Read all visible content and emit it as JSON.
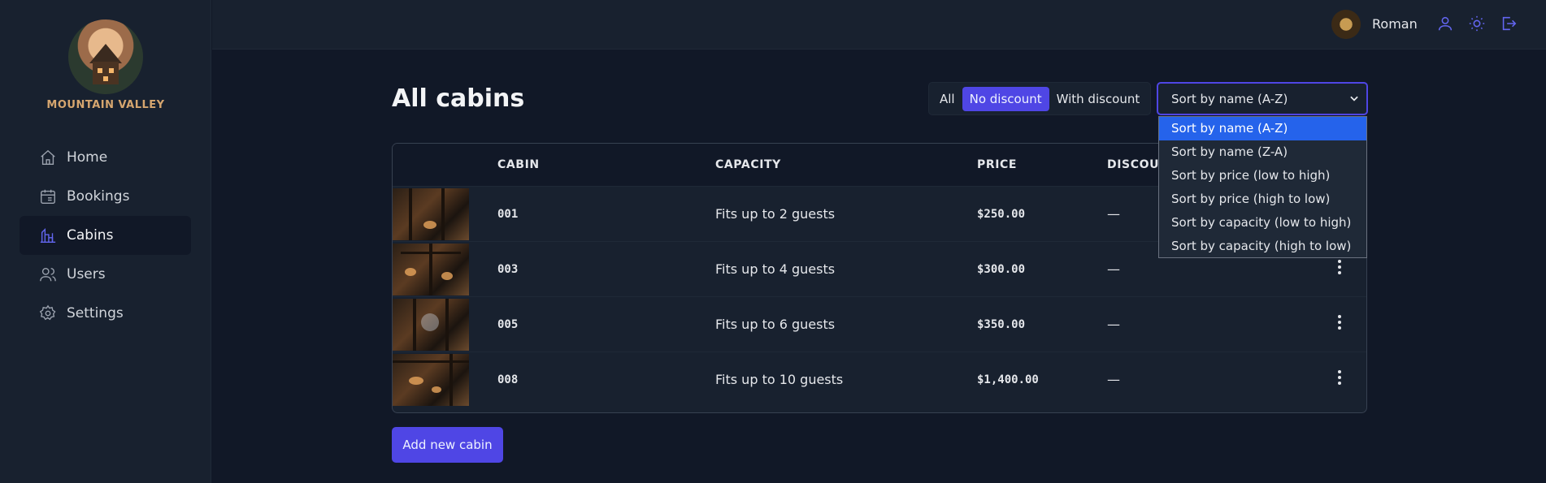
{
  "brand": {
    "name": "MOUNTAIN VALLEY"
  },
  "sidebar": {
    "items": [
      {
        "label": "Home",
        "icon": "home-icon"
      },
      {
        "label": "Bookings",
        "icon": "calendar-icon"
      },
      {
        "label": "Cabins",
        "icon": "cabins-icon",
        "active": true
      },
      {
        "label": "Users",
        "icon": "users-icon"
      },
      {
        "label": "Settings",
        "icon": "gear-icon"
      }
    ]
  },
  "header": {
    "user_name": "Roman",
    "icons": [
      "user-icon",
      "sun-icon",
      "logout-icon"
    ]
  },
  "main": {
    "title": "All cabins",
    "filter": {
      "options": [
        "All",
        "No discount",
        "With discount"
      ],
      "active": "No discount"
    },
    "sort": {
      "value": "Sort by name (A-Z)",
      "options": [
        "Sort by name (A-Z)",
        "Sort by name (Z-A)",
        "Sort by price (low to high)",
        "Sort by price (high to low)",
        "Sort by capacity (low to high)",
        "Sort by capacity (high to low)"
      ]
    },
    "table": {
      "headers": [
        "",
        "Cabin",
        "Capacity",
        "Price",
        "Discount"
      ],
      "rows": [
        {
          "cabin": "001",
          "capacity": "Fits up to 2 guests",
          "price": "$250.00",
          "discount": "—"
        },
        {
          "cabin": "003",
          "capacity": "Fits up to 4 guests",
          "price": "$300.00",
          "discount": "—"
        },
        {
          "cabin": "005",
          "capacity": "Fits up to 6 guests",
          "price": "$350.00",
          "discount": "—"
        },
        {
          "cabin": "008",
          "capacity": "Fits up to 10 guests",
          "price": "$1,400.00",
          "discount": "—"
        }
      ]
    },
    "add_button": "Add new cabin"
  },
  "colors": {
    "accent": "#4f46e5",
    "bg": "#111827",
    "panel": "#18212f",
    "selected_option": "#2563eb"
  }
}
